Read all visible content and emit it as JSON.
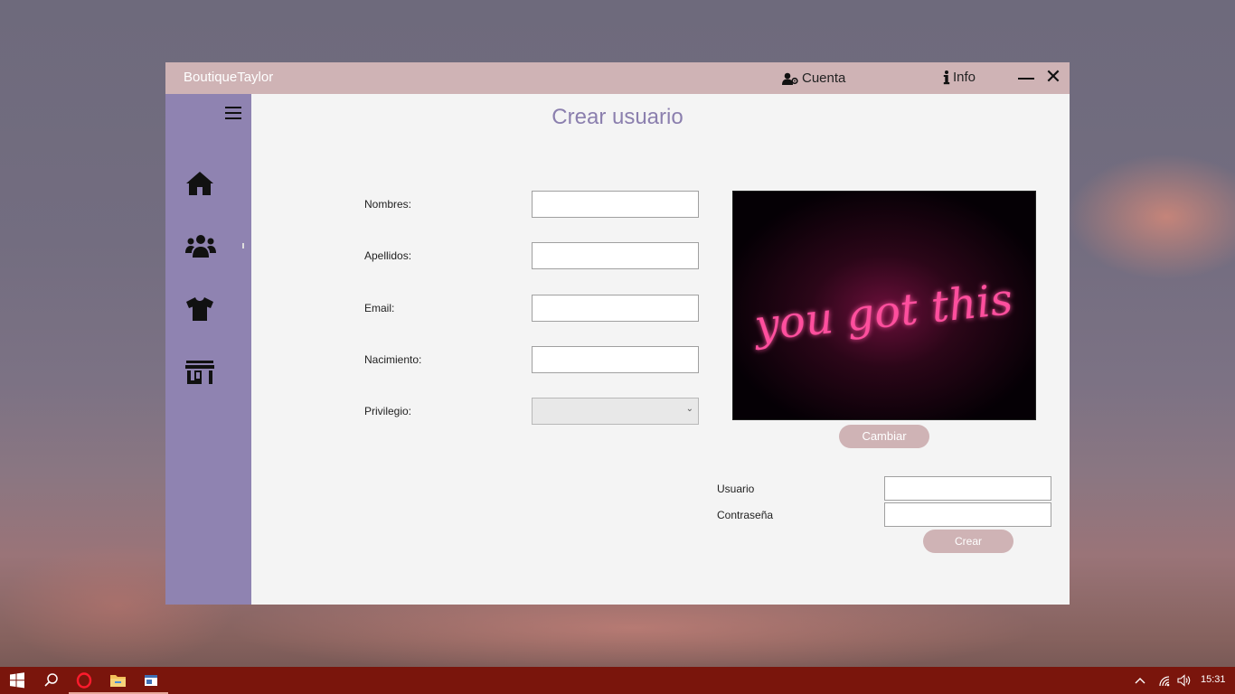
{
  "window": {
    "title": "BoutiqueTaylor",
    "account_label": "Cuenta",
    "info_label": "Info"
  },
  "sidebar": {
    "items": [
      {
        "icon": "home-icon"
      },
      {
        "icon": "users-icon"
      },
      {
        "icon": "shirt-icon"
      },
      {
        "icon": "store-icon"
      }
    ]
  },
  "page": {
    "title": "Crear usuario"
  },
  "form": {
    "nombres_label": "Nombres:",
    "nombres_value": "",
    "apellidos_label": "Apellidos:",
    "apellidos_value": "",
    "email_label": "Email:",
    "email_value": "",
    "nacimiento_label": "Nacimiento:",
    "nacimiento_value": "",
    "privilegio_label": "Privilegio:",
    "privilegio_value": ""
  },
  "photo": {
    "neon_text": "you got this",
    "change_label": "Cambiar"
  },
  "credentials": {
    "usuario_label": "Usuario",
    "usuario_value": "",
    "password_label": "Contraseña",
    "password_value": "",
    "create_label": "Crear"
  },
  "taskbar": {
    "time": "15:31"
  },
  "colors": {
    "titlebar": "#cfb3b5",
    "sidebar": "#8f83b1",
    "accent_title": "#8b7fae",
    "taskbar": "#7a150c"
  }
}
